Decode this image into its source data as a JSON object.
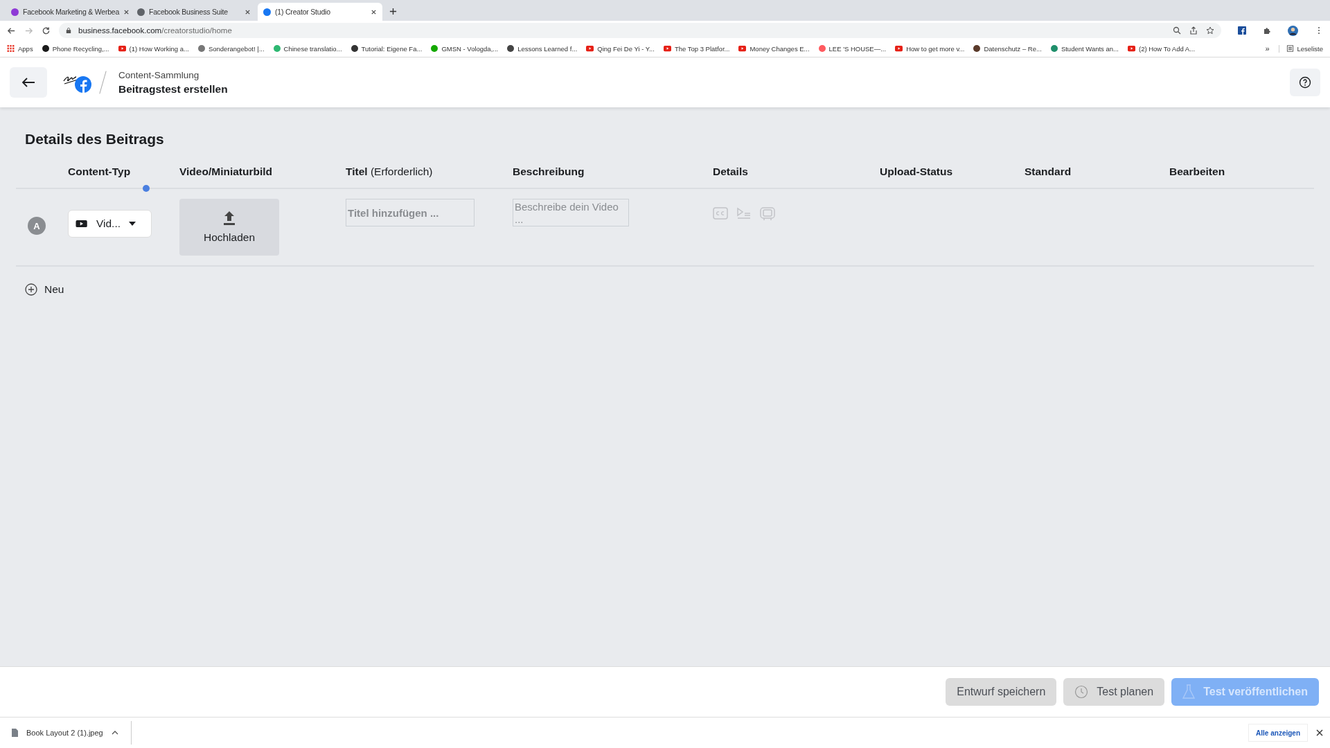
{
  "browser": {
    "tabs": [
      {
        "title": "Facebook Marketing & Werbea",
        "selected": false,
        "color": "#8e3ad6"
      },
      {
        "title": "Facebook Business Suite",
        "selected": false,
        "color": "#5f6368"
      },
      {
        "title": "(1) Creator Studio",
        "selected": true,
        "color": "#1877f2"
      }
    ],
    "url_host": "business.facebook.com",
    "url_path": "/creatorstudio/home",
    "bookmarks": [
      {
        "label": "Apps",
        "kind": "apps",
        "color": "#e94235"
      },
      {
        "label": "Phone Recycling,...",
        "kind": "site",
        "color": "#1a1a1a"
      },
      {
        "label": "(1) How Working a...",
        "kind": "video",
        "color": "#e62117"
      },
      {
        "label": "Sonderangebot! |...",
        "kind": "site",
        "color": "#777777"
      },
      {
        "label": "Chinese translatio...",
        "kind": "site",
        "color": "#2eb872"
      },
      {
        "label": "Tutorial: Eigene Fa...",
        "kind": "site",
        "color": "#333333"
      },
      {
        "label": "GMSN - Vologda,...",
        "kind": "site",
        "color": "#14a800"
      },
      {
        "label": "Lessons Learned f...",
        "kind": "site",
        "color": "#444444"
      },
      {
        "label": "Qing Fei De Yi - Y...",
        "kind": "video",
        "color": "#e62117"
      },
      {
        "label": "The Top 3 Platfor...",
        "kind": "video",
        "color": "#e62117"
      },
      {
        "label": "Money Changes E...",
        "kind": "video",
        "color": "#e62117"
      },
      {
        "label": "LEE 'S HOUSE—...",
        "kind": "site",
        "color": "#ff5a5f"
      },
      {
        "label": "How to get more v...",
        "kind": "video",
        "color": "#e62117"
      },
      {
        "label": "Datenschutz – Re...",
        "kind": "site",
        "color": "#5a3a2a"
      },
      {
        "label": "Student Wants an...",
        "kind": "site",
        "color": "#1f8f6b"
      },
      {
        "label": "(2) How To Add A...",
        "kind": "video",
        "color": "#e62117"
      }
    ],
    "overflow": "»",
    "reading_list": "Leseliste"
  },
  "header": {
    "parent": "Content-Sammlung",
    "title": "Beitragstest erstellen"
  },
  "section_title": "Details des Beitrags",
  "table": {
    "columns": [
      "Content-Typ",
      "Video/Miniaturbild",
      "**Titel** (Erforderlich)",
      "Beschreibung",
      "Details",
      "Upload-Status",
      "Standard",
      "Bearbeiten"
    ],
    "rows": [
      {
        "label": "A",
        "content_type": "Vid...",
        "upload": "Hochladen",
        "title_placeholder": "Titel hinzufügen ...",
        "description_placeholder": "Beschreibe dein Video ..."
      }
    ]
  },
  "add_label": "Neu",
  "footer_buttons": [
    {
      "label": "Entwurf speichern",
      "kind": "plain",
      "disabled": false
    },
    {
      "label": "Test planen",
      "kind": "clock",
      "disabled": false
    },
    {
      "label": "Test veröffentlichen",
      "kind": "primary",
      "disabled": true
    }
  ],
  "download": {
    "file": "Book Layout 2 (1).jpeg",
    "show_all": "Alle anzeigen"
  }
}
